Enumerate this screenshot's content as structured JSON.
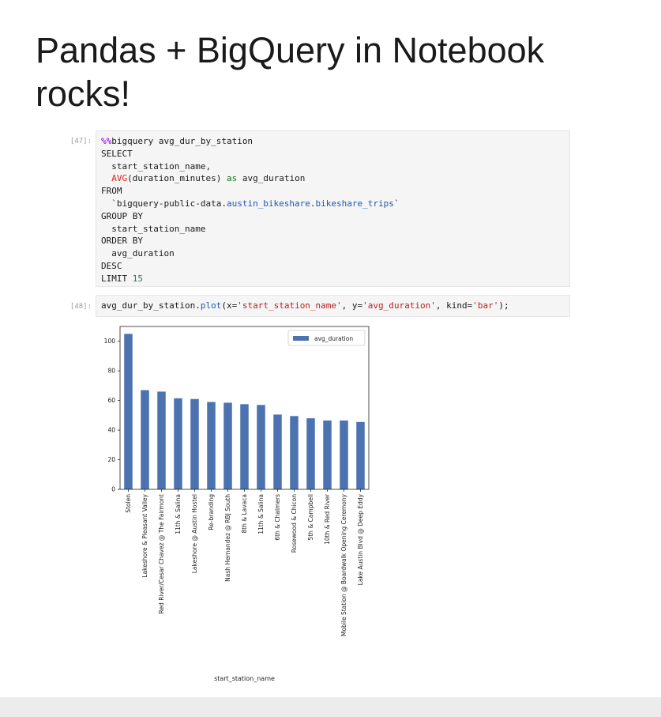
{
  "slide": {
    "title": "Pandas + BigQuery in Notebook rocks!"
  },
  "cells": [
    {
      "prompt": "[47]:",
      "lines": [
        [
          {
            "t": "%%",
            "c": "kw-magic"
          },
          {
            "t": "bigquery avg_dur_by_station"
          }
        ],
        [
          {
            "t": "SELECT"
          }
        ],
        [
          {
            "t": "  start_station_name,"
          }
        ],
        [
          {
            "t": "  "
          },
          {
            "t": "AVG",
            "c": "kw-red"
          },
          {
            "t": "(duration_minutes) "
          },
          {
            "t": "as",
            "c": "kw-green"
          },
          {
            "t": " avg_duration"
          }
        ],
        [
          {
            "t": "FROM"
          }
        ],
        [
          {
            "t": "  `bigquery-public-data."
          },
          {
            "t": "austin_bikeshare",
            "c": "lnk"
          },
          {
            "t": "."
          },
          {
            "t": "bikeshare_trips",
            "c": "lnk"
          },
          {
            "t": "`"
          }
        ],
        [
          {
            "t": "GROUP BY"
          }
        ],
        [
          {
            "t": "  start_station_name"
          }
        ],
        [
          {
            "t": "ORDER BY"
          }
        ],
        [
          {
            "t": "  avg_duration"
          }
        ],
        [
          {
            "t": "DESC"
          }
        ],
        [
          {
            "t": "LIMIT "
          },
          {
            "t": "15",
            "c": "num"
          }
        ]
      ]
    },
    {
      "prompt": "[48]:",
      "lines": [
        [
          {
            "t": "avg_dur_by_station."
          },
          {
            "t": "plot",
            "c": "lnk"
          },
          {
            "t": "(x="
          },
          {
            "t": "'start_station_name'",
            "c": "str"
          },
          {
            "t": ", y="
          },
          {
            "t": "'avg_duration'",
            "c": "str"
          },
          {
            "t": ", kind="
          },
          {
            "t": "'bar'",
            "c": "str"
          },
          {
            "t": ");"
          }
        ]
      ]
    }
  ],
  "chart_data": {
    "type": "bar",
    "categories": [
      "Stolen",
      "Lakeshore & Pleasant Valley",
      "Red River/Cesar Chavez @ The Fairmont",
      "11th & Salina",
      "Lakeshore @ Austin Hostel",
      "Re-branding",
      "Nash Hernandez @ RBJ South",
      "8th & Lavaca",
      "11th & Salina",
      "6th & Chalmers",
      "Rosewood & Chicon",
      "5th & Campbell",
      "10th & Red River",
      "Mobile Station @ Boardwalk Opening Ceremony",
      "Lake Austin Blvd @ Deep Eddy"
    ],
    "series": [
      {
        "name": "avg_duration",
        "values": [
          105,
          67,
          66,
          61.5,
          61,
          59,
          58.5,
          57.5,
          57,
          50.5,
          49.5,
          48,
          46.5,
          46.5,
          45.5
        ]
      }
    ],
    "xlabel": "start_station_name",
    "ylabel": "",
    "ylim": [
      0,
      110
    ],
    "yticks": [
      "0",
      "20",
      "40",
      "60",
      "80",
      "100"
    ],
    "legend": "top-right",
    "bar_color": "#4c72b0",
    "grid": false
  }
}
